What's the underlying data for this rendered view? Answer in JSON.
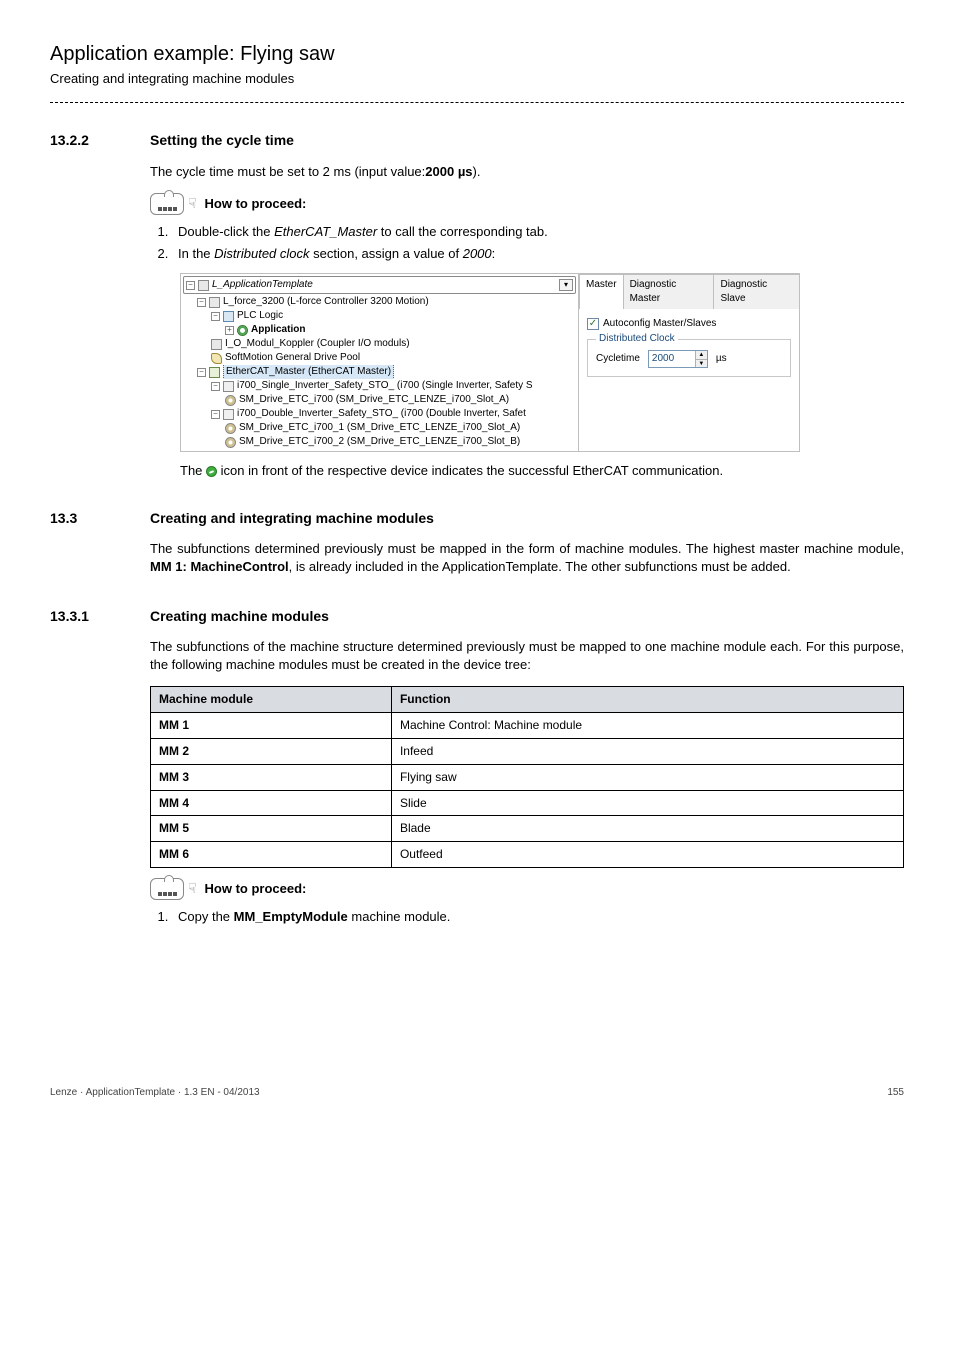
{
  "header": {
    "title": "Application example: Flying saw",
    "subtitle": "Creating and integrating machine modules"
  },
  "s1": {
    "num": "13.2.2",
    "title": "Setting the cycle time",
    "intro_pre": "The cycle time must be set to 2 ms (input value:",
    "intro_bold": "2000 µs",
    "intro_post": ").",
    "proceed": "How to proceed:",
    "step1_pre": "Double-click the ",
    "step1_it": "EtherCAT_Master",
    "step1_post": " to call the corresponding tab.",
    "step2_pre": "In the ",
    "step2_it1": "Distributed clock",
    "step2_mid": " section, assign a value of ",
    "step2_it2": "2000",
    "step2_post": ":",
    "note_pre": "The ",
    "note_post": " icon in front of the respective device indicates the successful EtherCAT communication."
  },
  "shot": {
    "root": "L_ApplicationTemplate",
    "n1": "L_force_3200 (L-force Controller 3200 Motion)",
    "n2": "PLC Logic",
    "n3": "Application",
    "n4": "I_O_Modul_Koppler (Coupler I/O moduls)",
    "n5": "SoftMotion General Drive Pool",
    "n6": "EtherCAT_Master (EtherCAT Master)",
    "n7": "i700_Single_Inverter_Safety_STO_ (i700 (Single Inverter, Safety S",
    "n8": "SM_Drive_ETC_i700 (SM_Drive_ETC_LENZE_i700_Slot_A)",
    "n9": "i700_Double_Inverter_Safety_STO_ (i700 (Double Inverter, Safet",
    "n10": "SM_Drive_ETC_i700_1 (SM_Drive_ETC_LENZE_i700_Slot_A)",
    "n11": "SM_Drive_ETC_i700_2 (SM_Drive_ETC_LENZE_i700_Slot_B)",
    "tab1": "Master",
    "tab2": "Diagnostic Master",
    "tab3": "Diagnostic Slave",
    "chk": "Autoconfig Master/Slaves",
    "group": "Distributed Clock",
    "field_label": "Cycletime",
    "field_value": "2000",
    "unit": "µs"
  },
  "s2": {
    "num": "13.3",
    "title": "Creating and integrating machine modules",
    "p_a": "The subfunctions determined previously must be mapped in the form of machine modules. The highest master machine module, ",
    "p_bold": "MM 1: MachineControl",
    "p_b": ", is already included in the ApplicationTemplate. The other subfunctions must be added."
  },
  "s3": {
    "num": "13.3.1",
    "title": "Creating machine modules",
    "p": "The subfunctions of the machine structure determined previously must be mapped to one machine module each. For this purpose, the following machine modules must be created in the device tree:",
    "th1": "Machine module",
    "th2": "Function",
    "rows": [
      {
        "c1": "MM 1",
        "c2": "Machine Control: Machine module"
      },
      {
        "c1": "MM 2",
        "c2": "Infeed"
      },
      {
        "c1": "MM 3",
        "c2": "Flying saw"
      },
      {
        "c1": "MM 4",
        "c2": "Slide"
      },
      {
        "c1": "MM 5",
        "c2": "Blade"
      },
      {
        "c1": "MM 6",
        "c2": "Outfeed"
      }
    ],
    "proceed": " How to proceed:",
    "step1_pre": "Copy the ",
    "step1_bold": "MM_EmptyModule",
    "step1_post": " machine module."
  },
  "footer": {
    "left": "Lenze · ApplicationTemplate · 1.3 EN - 04/2013",
    "right": "155"
  }
}
